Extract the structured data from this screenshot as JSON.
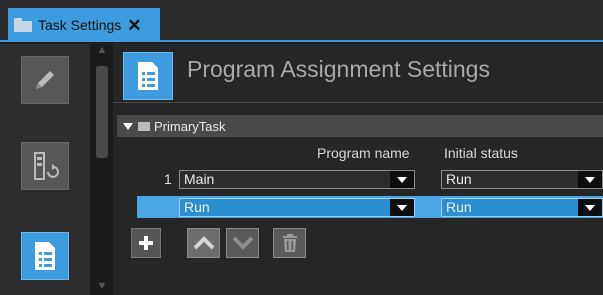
{
  "tab": {
    "title": "Task Settings",
    "close_glyph": "✕"
  },
  "toolbar": {
    "items": [
      "pencil-icon",
      "io-map-icon",
      "program-list-icon"
    ]
  },
  "header": {
    "title": "Program Assignment Settings",
    "icon": "program-list-icon"
  },
  "section": {
    "label": "PrimaryTask"
  },
  "table": {
    "columns": [
      "Program name",
      "Initial status"
    ],
    "rows": [
      {
        "number": "1",
        "program": "Main",
        "status": "Run"
      },
      {
        "number": "",
        "program": "Run",
        "status": "Run"
      }
    ]
  },
  "buttons": [
    "add-icon",
    "move-up-icon",
    "move-down-icon",
    "delete-icon"
  ],
  "colors": {
    "accent": "#3c9cdf",
    "selection": "#2a8ed1",
    "background": "#262626"
  }
}
